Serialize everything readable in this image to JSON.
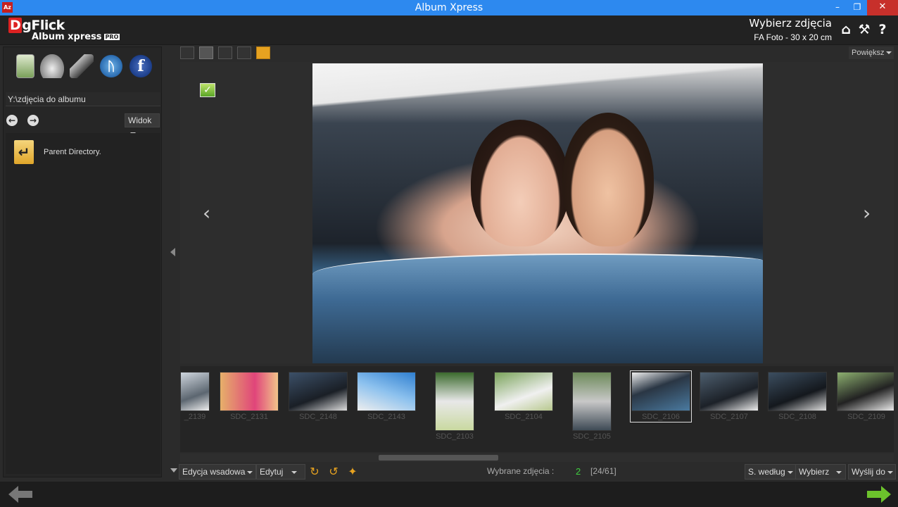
{
  "window": {
    "title": "Album Xpress",
    "app_icon": "Az"
  },
  "header": {
    "brand": "gFlick",
    "brand_d": "D",
    "product": "Album xpress",
    "pro_badge": "PRO",
    "title": "Wybierz zdjęcia",
    "subtitle": "FA Foto - 30 x 20 cm"
  },
  "left_panel": {
    "path": "Y:\\zdjęcia do albumu",
    "view_label": "Widok",
    "items": [
      {
        "label": "Parent Directory."
      }
    ]
  },
  "viewer": {
    "zoom_label": "Powiększ"
  },
  "filmstrip": {
    "thumbs": [
      {
        "label": "_2139"
      },
      {
        "label": "SDC_2131"
      },
      {
        "label": "SDC_2148"
      },
      {
        "label": "SDC_2143"
      },
      {
        "label": "SDC_2103"
      },
      {
        "label": "SDC_2104"
      },
      {
        "label": "SDC_2105"
      },
      {
        "label": "SDC_2106"
      },
      {
        "label": "SDC_2107"
      },
      {
        "label": "SDC_2108"
      },
      {
        "label": "SDC_2109"
      }
    ]
  },
  "toolbar": {
    "batch_edit": "Edycja wsadowa",
    "edit": "Edytuj",
    "selected_label": "Wybrane zdjęcia :",
    "selected_count": "2",
    "selected_fraction": "[24/61]",
    "sort_by": "S. według",
    "select": "Wybierz",
    "send_to": "Wyślij do"
  },
  "colors": {
    "titlebar": "#2d89ef",
    "accent": "#e6a220",
    "check_green": "#5aa526",
    "next_green": "#6cc22c"
  }
}
